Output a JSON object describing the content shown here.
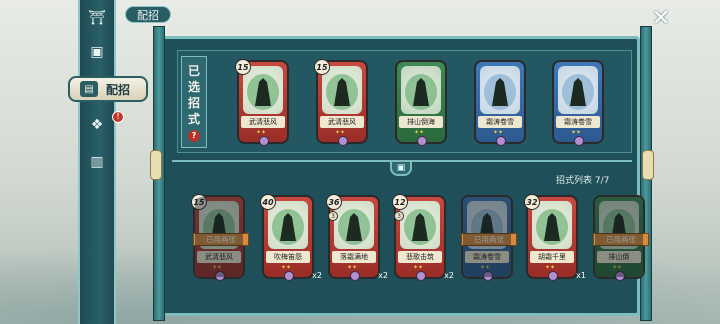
{
  "header": {
    "title": "配招"
  },
  "nav": {
    "active_label": "配招",
    "notice_badge": "!"
  },
  "selected_panel": {
    "title_chars": [
      "已",
      "选",
      "招",
      "式"
    ],
    "help": "?",
    "cards": [
      {
        "name": "武清悲风",
        "cost": "15",
        "color": "red",
        "icon": "hand-icon"
      },
      {
        "name": "武清悲风",
        "cost": "15",
        "color": "red",
        "icon": "hand-icon"
      },
      {
        "name": "排山倒海",
        "cost": "",
        "color": "green",
        "icon": "figure-icon"
      },
      {
        "name": "霜涛卷雪",
        "cost": "",
        "color": "blue",
        "icon": "figure-icon"
      },
      {
        "name": "霜涛卷雪",
        "cost": "",
        "color": "blue",
        "icon": "figure-icon"
      }
    ]
  },
  "list_panel": {
    "label": "招式列表 7/7",
    "used_label": "已用两张",
    "cards": [
      {
        "name": "武清悲风",
        "cost": "15",
        "color": "red",
        "used": true,
        "count": ""
      },
      {
        "name": "吹梅笛怨",
        "cost": "40",
        "color": "red",
        "used": false,
        "count": "x2"
      },
      {
        "name": "落霜满地",
        "cost": "36",
        "color": "red",
        "used": false,
        "count": "x2",
        "sub": "3"
      },
      {
        "name": "悲歌击筑",
        "cost": "12",
        "color": "red",
        "used": false,
        "count": "x2",
        "sub": "3"
      },
      {
        "name": "霜涛卷雪",
        "cost": "",
        "color": "blue",
        "used": true,
        "count": ""
      },
      {
        "name": "胡霜千里",
        "cost": "32",
        "color": "red",
        "used": false,
        "count": "x1"
      },
      {
        "name": "排山倒",
        "cost": "",
        "color": "green",
        "used": true,
        "count": ""
      }
    ]
  },
  "icons": {
    "close": "close-icon",
    "divider": "scroll-icon"
  },
  "colors": {
    "frame": "#1f4f59",
    "accent": "#7dbdbc",
    "used_banner": "#d98a3d"
  }
}
